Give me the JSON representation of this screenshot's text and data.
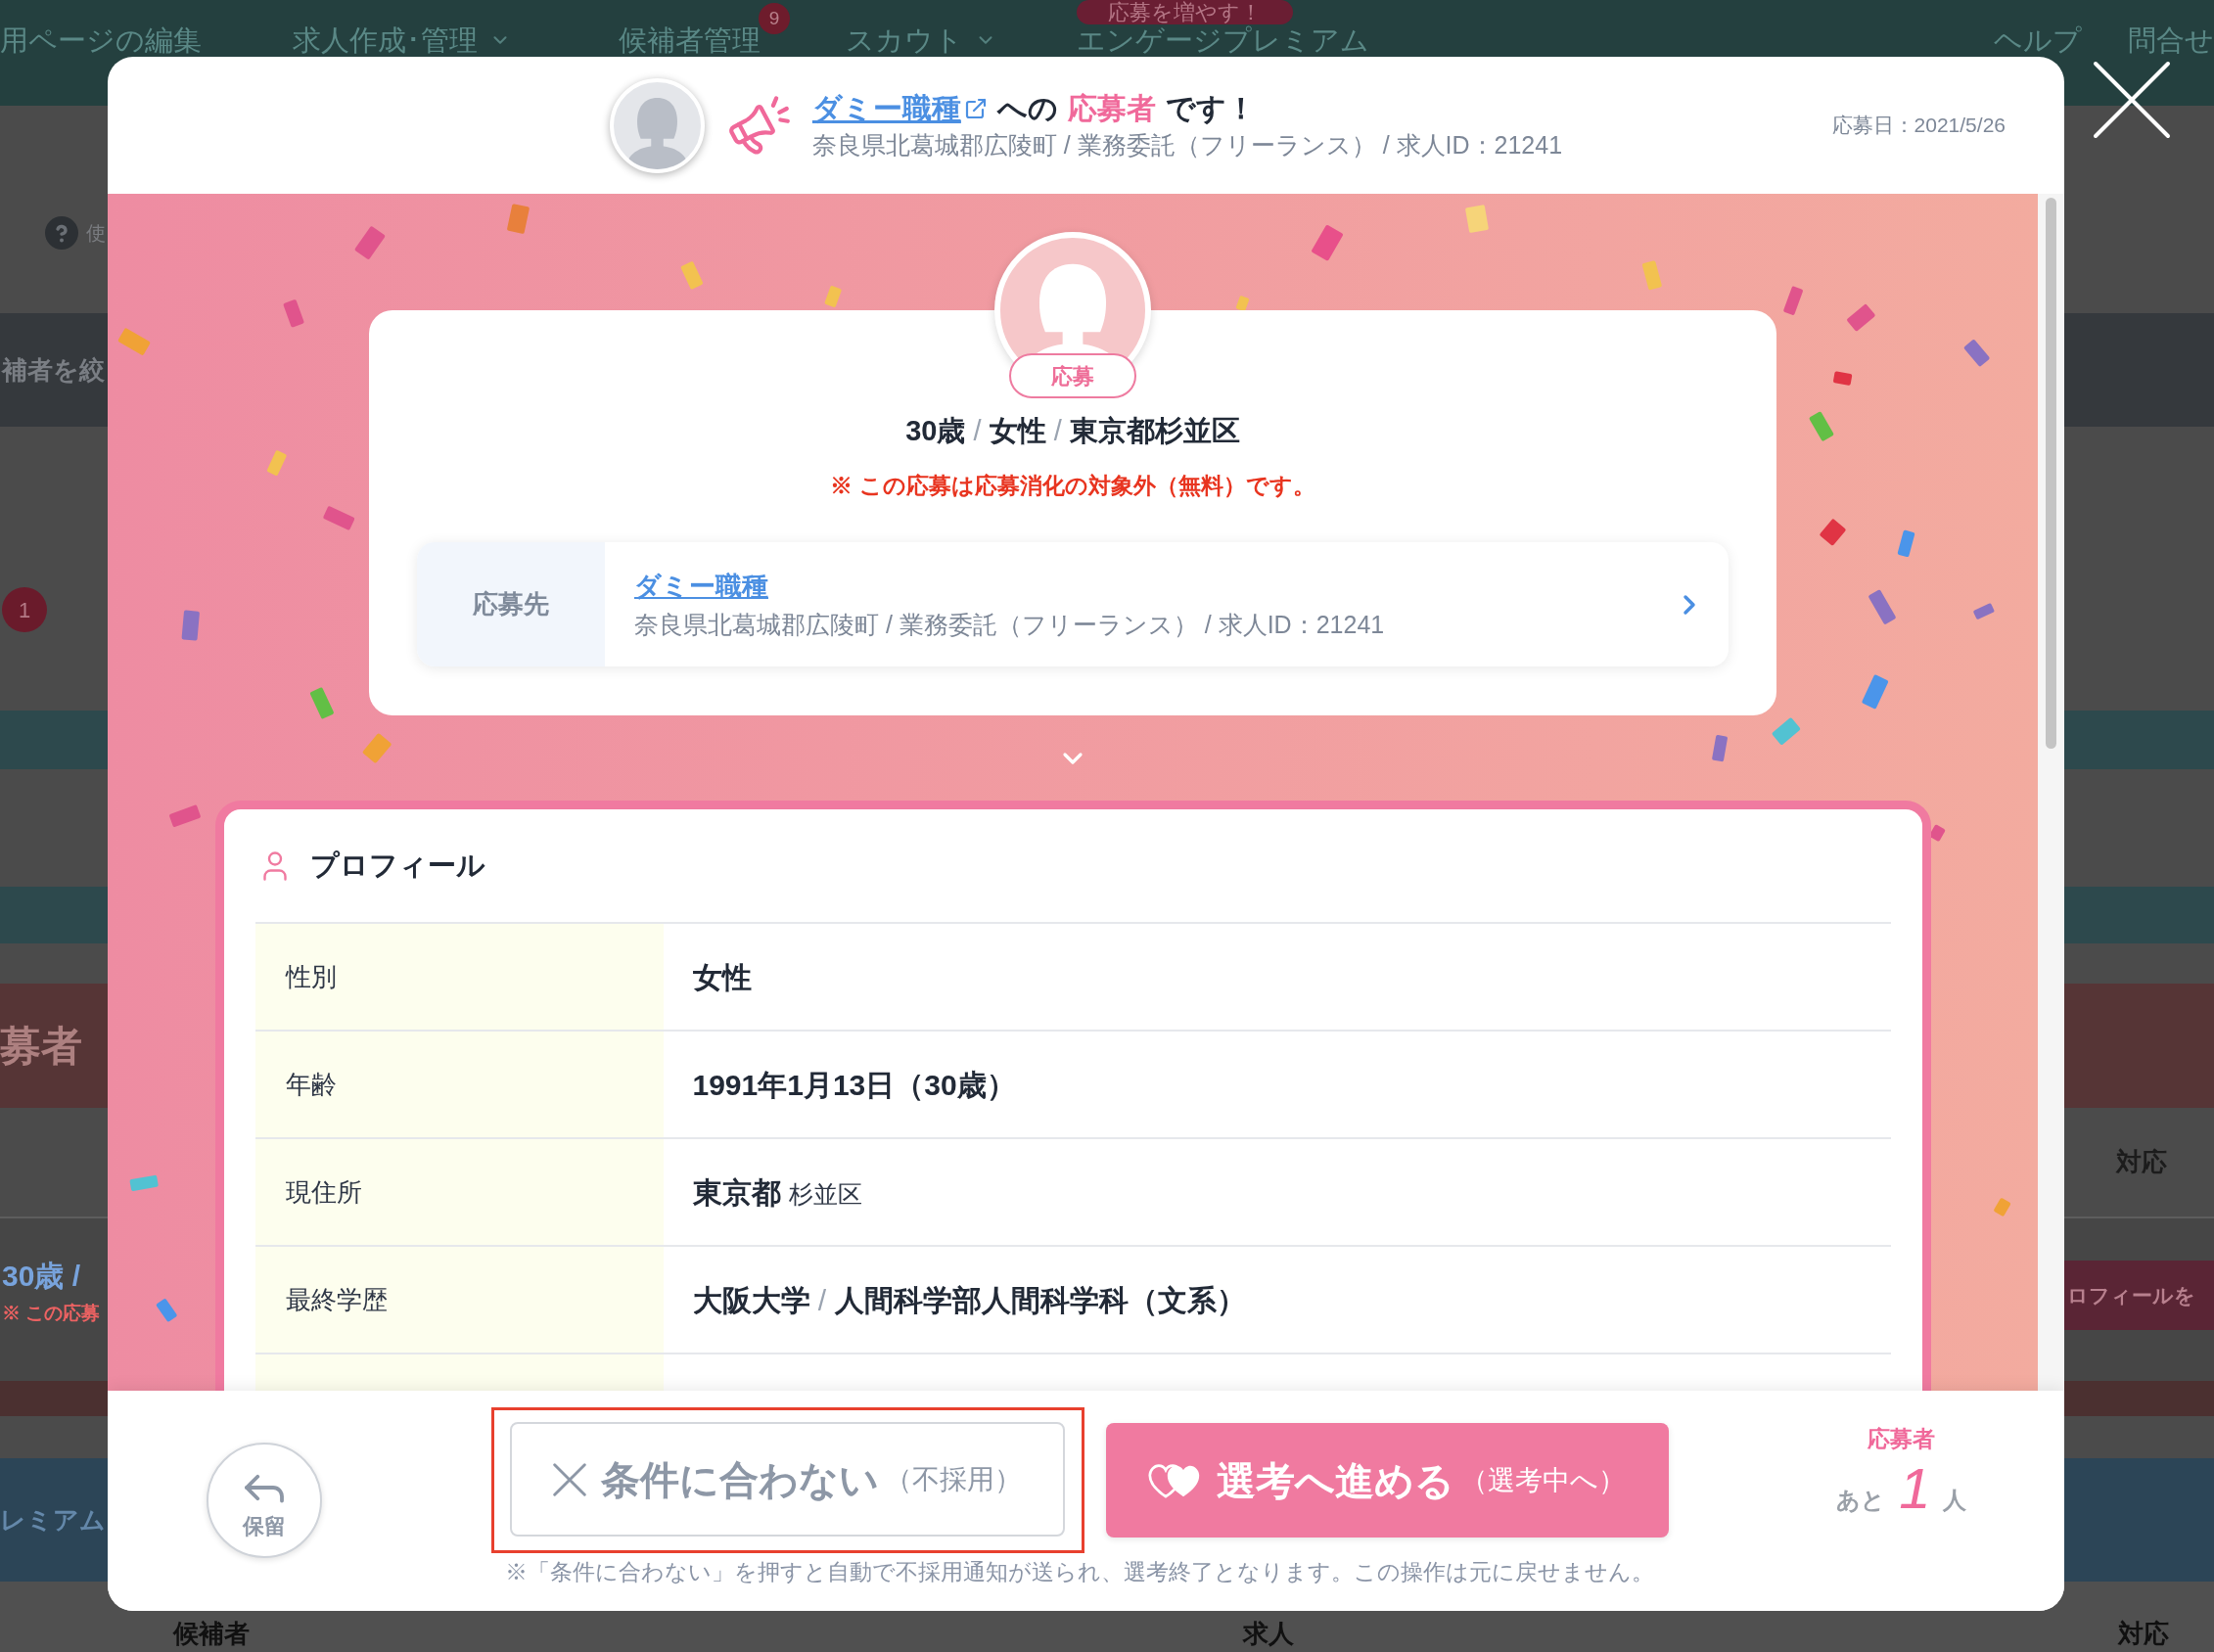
{
  "background_page": {
    "nav_items": [
      {
        "label": "用ページの編集",
        "kind": "link"
      },
      {
        "label": "求人作成･管理",
        "kind": "dropdown"
      },
      {
        "label": "候補者管理",
        "kind": "link",
        "badge": "9"
      },
      {
        "label": "スカウト",
        "kind": "dropdown"
      },
      {
        "label": "エンゲージプレミアム",
        "kind": "link",
        "tag": "応募を増やす！"
      },
      {
        "label": "ヘルプ",
        "kind": "utility"
      },
      {
        "label": "問合せ",
        "kind": "utility"
      }
    ],
    "help_label": "使",
    "filter_label": "補者を絞",
    "count_badge": "1",
    "section_title": "募者",
    "table_header": "対応",
    "candidate_summary": "30歳 /",
    "candidate_note": "※ この応募",
    "profile_button": "ロフィールを",
    "banner_label": "レミアム",
    "footer_columns": [
      "候補者",
      "求人",
      "対応"
    ]
  },
  "modal": {
    "header": {
      "job_link": "ダミー職種",
      "title_middle": "への",
      "title_highlight": "応募者",
      "title_end": "です！",
      "job_details": "奈良県北葛城郡広陵町 / 業務委託（フリーランス） / 求人ID：21241",
      "applied_date": "応募日：2021/5/26"
    },
    "applicant": {
      "status_badge": "応募",
      "summary": [
        {
          "text": "30歳",
          "kind": "value"
        },
        {
          "text": "/",
          "kind": "separator"
        },
        {
          "text": "女性",
          "kind": "value"
        },
        {
          "text": "/",
          "kind": "separator"
        },
        {
          "text": "東京都杉並区",
          "kind": "value"
        }
      ],
      "notice": "※ この応募は応募消化の対象外（無料）です。",
      "destination": {
        "label": "応募先",
        "job_link": "ダミー職種",
        "details": "奈良県北葛城郡広陵町 / 業務委託（フリーランス） / 求人ID：21241"
      }
    },
    "profile": {
      "title": "プロフィール",
      "rows": [
        {
          "label": "性別",
          "value": [
            {
              "text": "女性",
              "kind": "strong"
            }
          ]
        },
        {
          "label": "年齢",
          "value": [
            {
              "text": "1991年1月13日（30歳）",
              "kind": "strong"
            }
          ]
        },
        {
          "label": "現住所",
          "value": [
            {
              "text": "東京都",
              "kind": "strong"
            },
            {
              "text": "杉並区",
              "kind": "plain"
            }
          ]
        },
        {
          "label": "最終学歴",
          "value": [
            {
              "text": "大阪大学",
              "kind": "strong"
            },
            {
              "text": "/",
              "kind": "separator"
            },
            {
              "text": "人間科学部人間科学科（文系）",
              "kind": "strong"
            }
          ]
        }
      ]
    },
    "actions": {
      "hold": "保留",
      "reject": {
        "label": "条件に合わない",
        "sub": "（不採用）",
        "highlighted": true
      },
      "advance": {
        "label": "選考へ進める",
        "sub": "（選考中へ）"
      },
      "notice": "※「条件に合わない」を押すと自動で不採用通知が送られ、選考終了となります。この操作は元に戻せません。",
      "remaining": {
        "title": "応募者",
        "prefix": "あと",
        "count": "1",
        "suffix": "人"
      }
    }
  }
}
